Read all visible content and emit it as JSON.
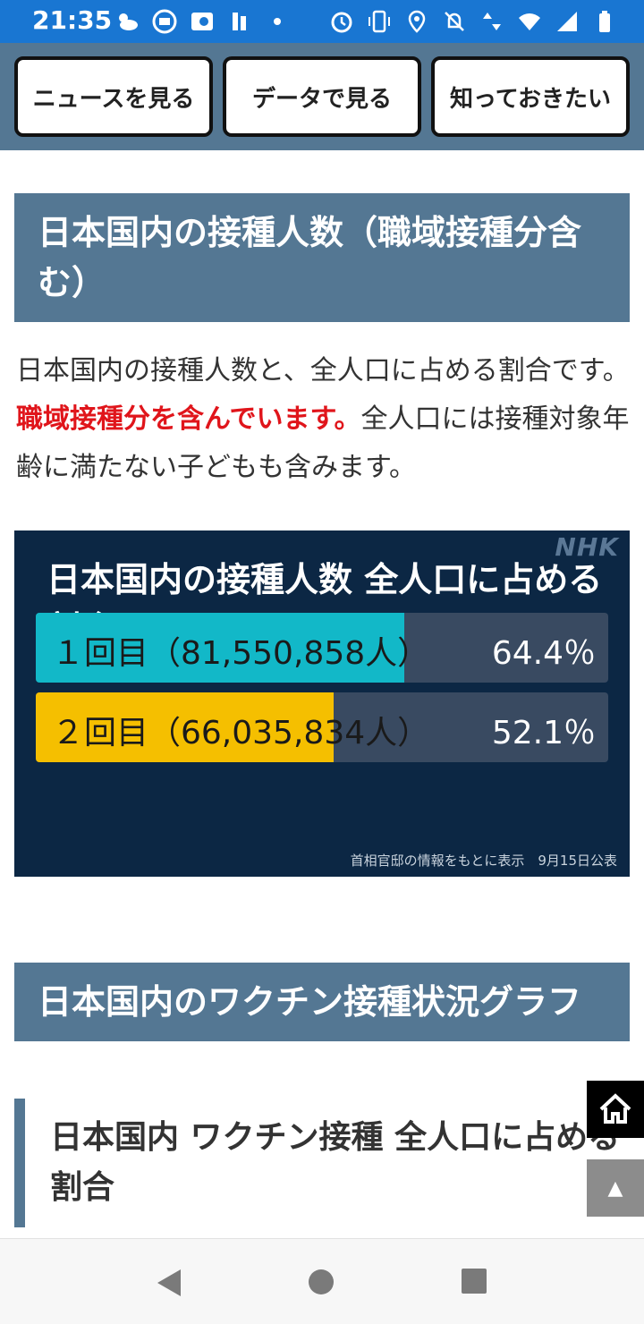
{
  "status_bar": {
    "time": "21:35",
    "left_icons": [
      "cloud-sun-icon",
      "sf-icon",
      "app-icon",
      "figure-icon",
      "dot-icon"
    ],
    "right_icons": [
      "alarm-icon",
      "vibrate-icon",
      "location-icon",
      "dnd-off-icon",
      "data-arrows-icon",
      "wifi-icon",
      "signal-icon",
      "battery-icon"
    ]
  },
  "top_nav": {
    "items": [
      {
        "label": "ニュースを見る"
      },
      {
        "label": "データで見る"
      },
      {
        "label": "知っておきたい"
      }
    ]
  },
  "section1": {
    "title": "日本国内の接種人数（職域接種分含む）",
    "body_prefix": "日本国内の接種人数と、全人口に占める割合です。",
    "body_highlight": "職域接種分を含んでいます。",
    "body_suffix": "全人口には接種対象年齢に満たない子どもも含みます。",
    "highlight_color": "#e0151b"
  },
  "vaccination_chart": {
    "logo": "NHK",
    "title": "日本国内の接種人数 全人口に占める割合",
    "bars": [
      {
        "label": "１回目（81,550,858人）",
        "percent_label": "64.4％",
        "value": 64.4,
        "color": "#12b8c8"
      },
      {
        "label": "２回目（66,035,834人）",
        "percent_label": "52.1％",
        "value": 52.1,
        "color": "#f5bf00"
      }
    ],
    "source": "首相官邸の情報をもとに表示　9月15日公表"
  },
  "section2": {
    "title": "日本国内のワクチン接種状況グラフ"
  },
  "sub_header": {
    "title": "日本国内 ワクチン接種 全人口に占める割合"
  },
  "floating": {
    "home_icon": "home-icon",
    "top_icon": "scroll-top-icon",
    "top_glyph": "▲"
  },
  "system_nav": {
    "icons": [
      "back-icon",
      "home-circle-icon",
      "recents-icon"
    ]
  },
  "colors": {
    "statusbar": "#1976d2",
    "header": "#547793",
    "chart_bg": "#0c2744"
  }
}
